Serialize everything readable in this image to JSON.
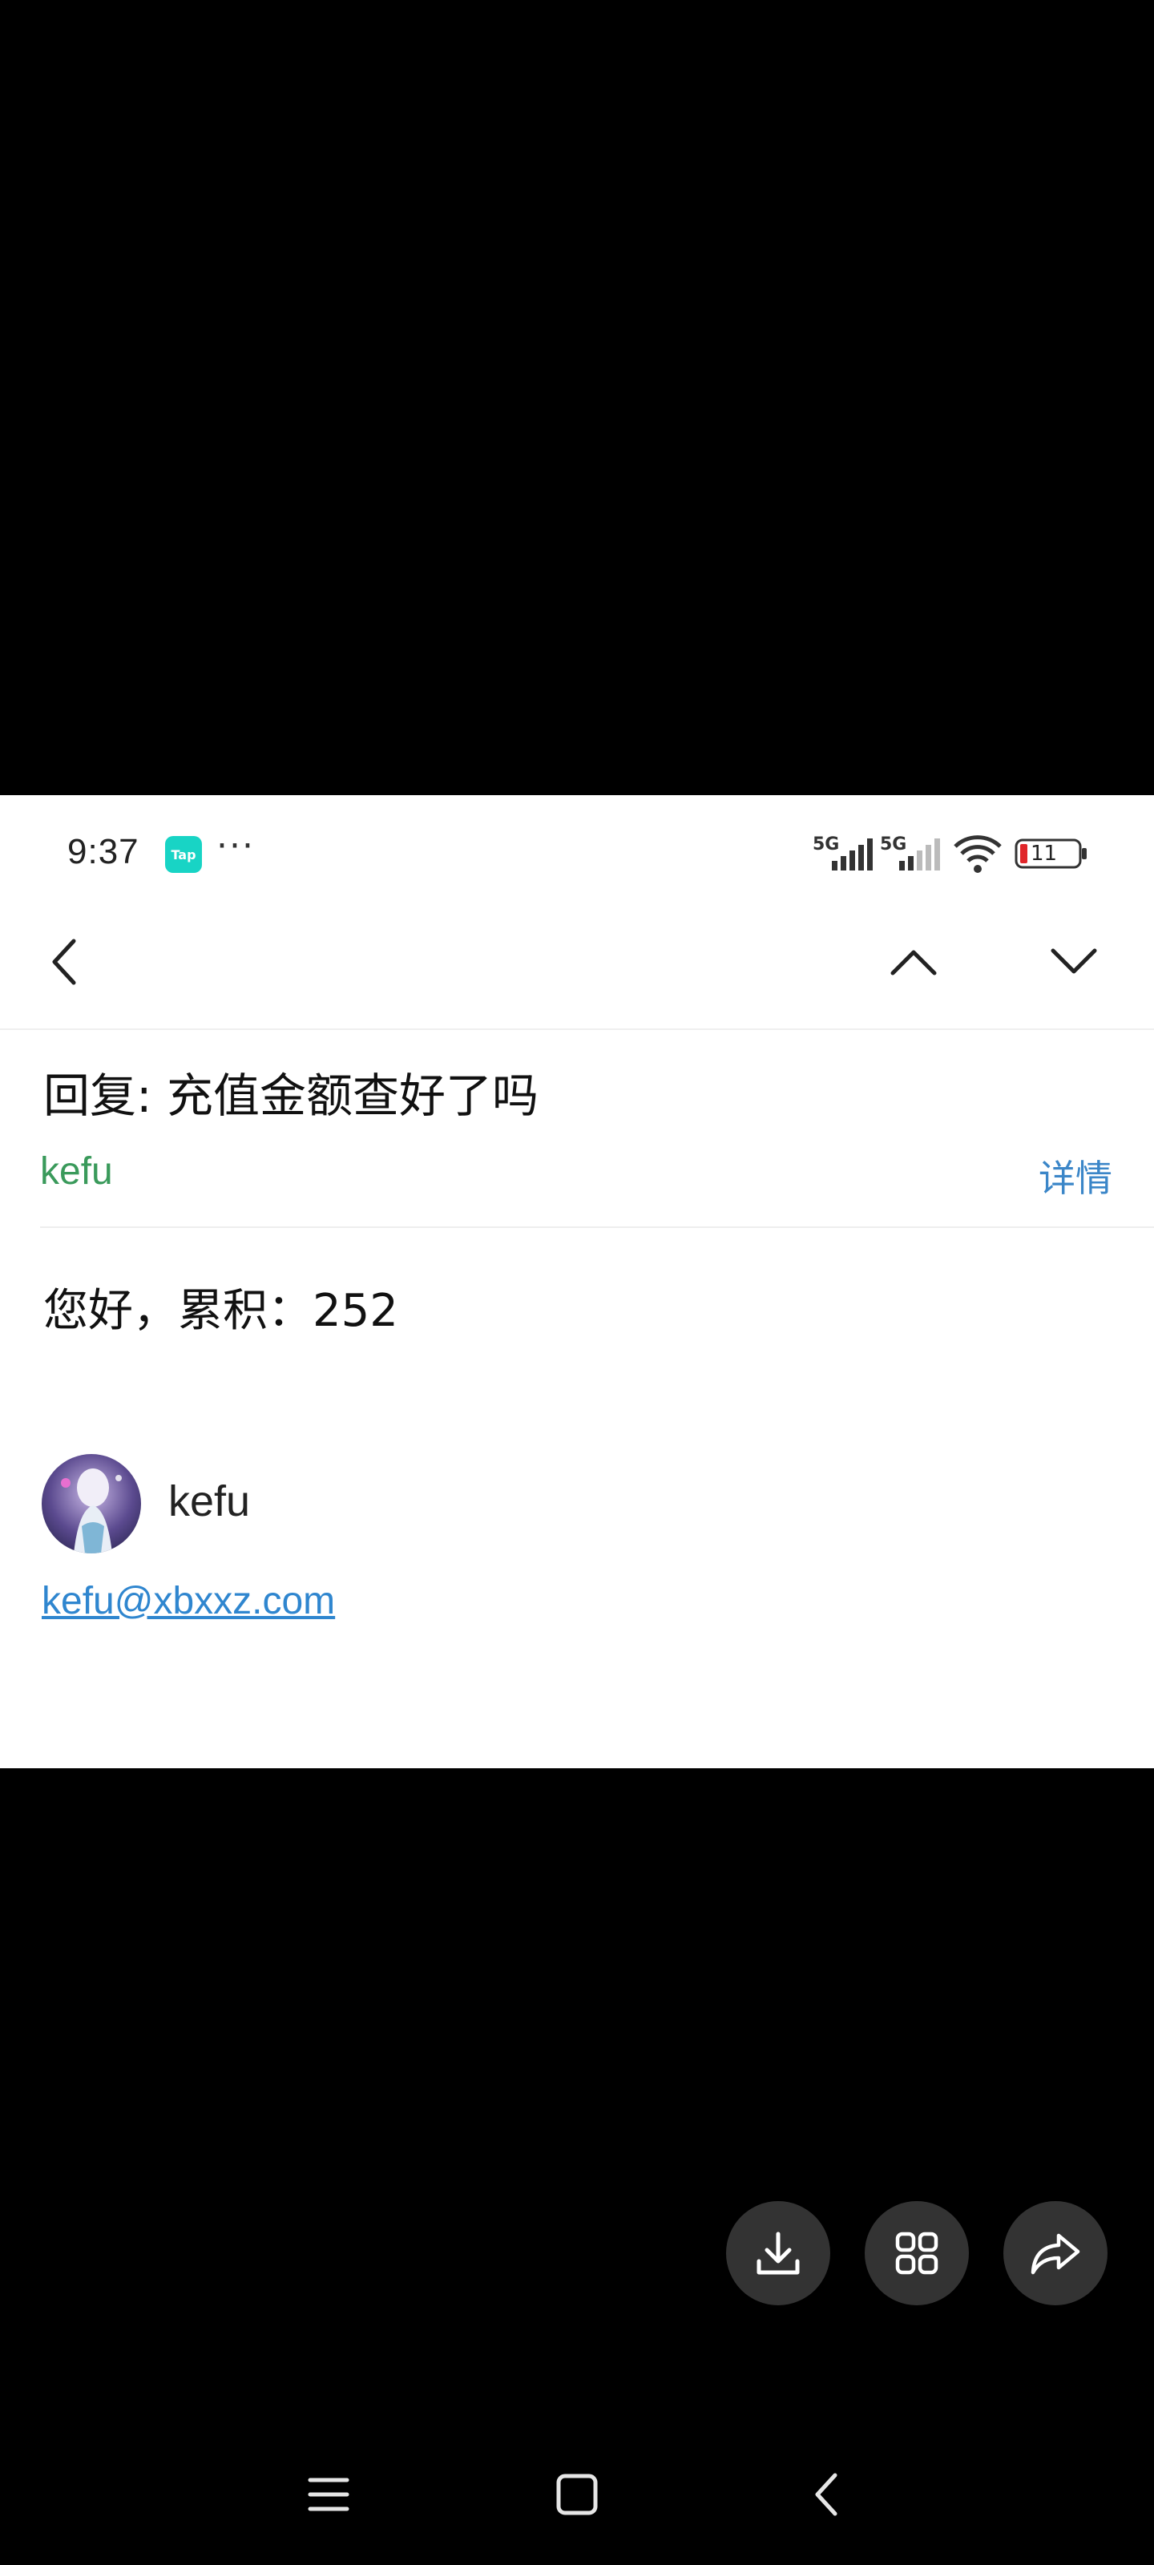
{
  "status_bar": {
    "time": "9:37",
    "app_badge": "Tap",
    "more": "···",
    "sim1_label": "5G",
    "sim2_label": "5G",
    "battery": "11"
  },
  "nav": {
    "back_icon": "chevron-left-icon",
    "prev_icon": "chevron-up-icon",
    "next_icon": "chevron-down-icon"
  },
  "mail": {
    "subject": "回复: 充值金额查好了吗",
    "sender": "kefu",
    "details_label": "详情",
    "body": "您好，累积：252",
    "signature_name": "kefu",
    "signature_email": "kefu@xbxxz.com"
  },
  "actions": {
    "download_icon": "download-icon",
    "grid_icon": "grid-icon",
    "share_icon": "share-icon"
  },
  "system_nav": {
    "menu_icon": "menu-icon",
    "home_icon": "home-icon",
    "back_icon": "back-icon"
  },
  "colors": {
    "sender": "#3a9a5b",
    "link": "#3b86c8",
    "badge": "#18d4c5",
    "battery_low": "#e0262a"
  }
}
